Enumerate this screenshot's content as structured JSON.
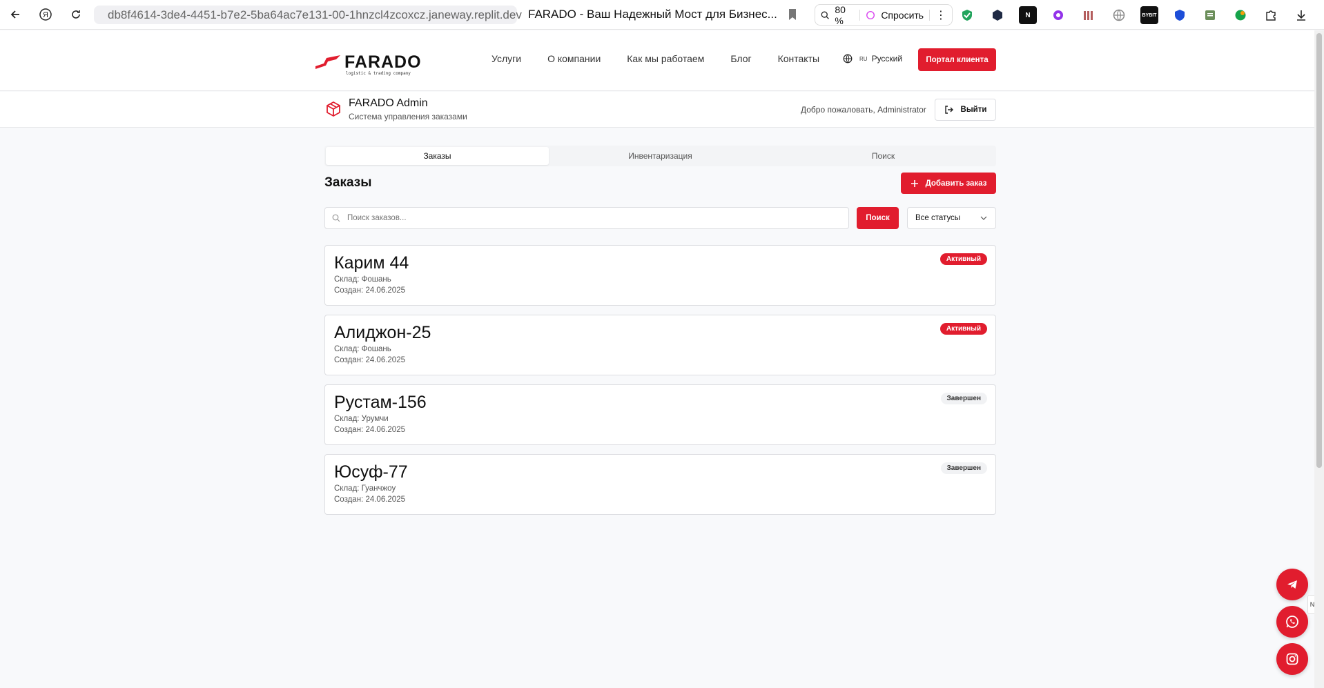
{
  "browser": {
    "url": "db8f4614-3de4-4451-b7e2-5ba64ac7e131-00-1hnzcl4zcoxcz.janeway.replit.dev",
    "tab_title": "FARADO - Ваш Надежный Мост для Бизнес...",
    "zoom": "80 %",
    "ask_label": "Спросить"
  },
  "site": {
    "logo_text": "FARADO",
    "logo_sub": "logistic & trading company",
    "nav": [
      "Услуги",
      "О компании",
      "Как мы работаем",
      "Блог",
      "Контакты"
    ],
    "lang_code": "RU",
    "lang_label": "Русский",
    "portal_label": "Портал клиента"
  },
  "admin": {
    "title": "FARADO Admin",
    "subtitle": "Система управления заказами",
    "welcome": "Добро пожаловать, Administrator",
    "logout_label": "Выйти"
  },
  "tabs": [
    {
      "label": "Заказы",
      "active": true
    },
    {
      "label": "Инвентаризация",
      "active": false
    },
    {
      "label": "Поиск",
      "active": false
    }
  ],
  "orders_section": {
    "title": "Заказы",
    "add_label": "Добавить заказ",
    "search_placeholder": "Поиск заказов...",
    "search_button": "Поиск",
    "status_filter": "Все статусы"
  },
  "orders": [
    {
      "name": "Карим 44",
      "warehouse": "Склад: Фошань",
      "created": "Создан: 24.06.2025",
      "status": "Активный",
      "status_type": "active"
    },
    {
      "name": "Алиджон-25",
      "warehouse": "Склад: Фошань",
      "created": "Создан: 24.06.2025",
      "status": "Активный",
      "status_type": "active"
    },
    {
      "name": "Рустам-156",
      "warehouse": "Склад: Урумчи",
      "created": "Создан: 24.06.2025",
      "status": "Завершен",
      "status_type": "done"
    },
    {
      "name": "Юсуф-77",
      "warehouse": "Склад: Гуанчжоу",
      "created": "Создан: 24.06.2025",
      "status": "Завершен",
      "status_type": "done"
    }
  ],
  "colors": {
    "accent": "#e11d2e"
  }
}
